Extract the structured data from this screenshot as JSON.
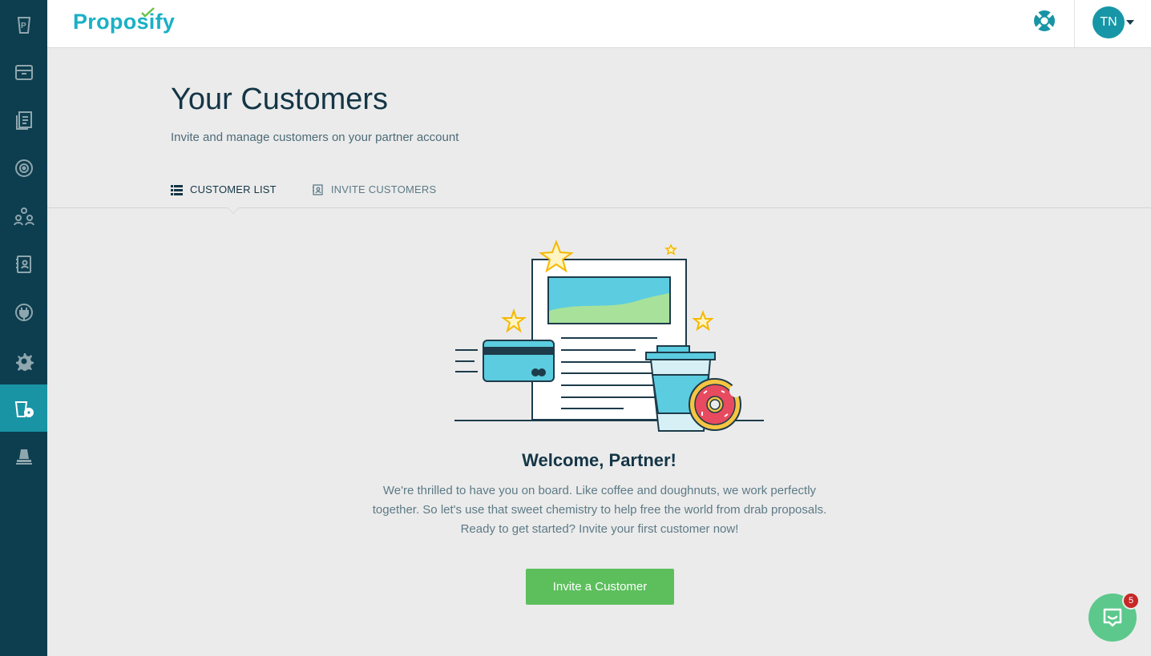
{
  "header": {
    "logo": "Proposify",
    "avatar_initials": "TN"
  },
  "sidebar": {
    "items": [
      {
        "icon": "proposify-cup-icon"
      },
      {
        "icon": "archive-box-icon"
      },
      {
        "icon": "documents-icon"
      },
      {
        "icon": "target-icon"
      },
      {
        "icon": "team-icon"
      },
      {
        "icon": "contacts-book-icon"
      },
      {
        "icon": "plug-icon"
      },
      {
        "icon": "gear-icon"
      },
      {
        "icon": "partner-customers-icon",
        "active": true
      },
      {
        "icon": "lamp-icon"
      }
    ]
  },
  "page": {
    "title": "Your Customers",
    "subtitle": "Invite and manage customers on your partner account"
  },
  "tabs": [
    {
      "label": "CUSTOMER LIST",
      "active": true
    },
    {
      "label": "INVITE CUSTOMERS",
      "active": false
    }
  ],
  "welcome": {
    "title": "Welcome, Partner!",
    "line1": "We're thrilled to have you on board. Like coffee and doughnuts, we work perfectly",
    "line2": "together. So let's use that sweet chemistry to help free the world from drab proposals.",
    "line3": "Ready to get started? Invite your first customer now!",
    "button": "Invite a Customer"
  },
  "chat": {
    "badge": "5"
  },
  "colors": {
    "sidebar": "#0d3e4f",
    "accent": "#1894a5",
    "brand": "#1ab1c5",
    "button": "#5cbf5c",
    "chat": "#5cc88c"
  }
}
